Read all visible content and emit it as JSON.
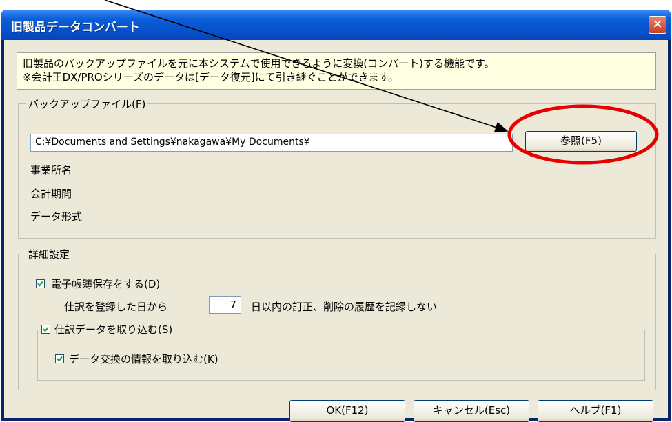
{
  "window": {
    "title": "旧製品データコンバート",
    "close_glyph": "✕"
  },
  "info": {
    "line1": "旧製品のバックアップファイルを元に本システムで使用できるように変換(コンバート)する機能です。",
    "line2": "※会計王DX/PROシリーズのデータは[データ復元]にて引き継ぐことができます。"
  },
  "backup": {
    "group_label": "バックアップファイル(F)",
    "path_value": "C:¥Documents and Settings¥nakagawa¥My Documents¥",
    "browse_label": "参照(F5)",
    "fields": [
      "事業所名",
      "会計期間",
      "データ形式"
    ]
  },
  "details": {
    "group_label": "詳細設定",
    "ebook_label": "電子帳簿保存をする(D)",
    "ebook_checked": true,
    "days_prefix": "仕訳を登録した日から",
    "days_value": "7",
    "days_suffix": "日以内の訂正、削除の履歴を記録しない",
    "import_journal_label": "仕訳データを取り込む(S)",
    "import_journal_checked": true,
    "import_exchange_label": "データ交換の情報を取り込む(K)",
    "import_exchange_checked": true
  },
  "buttons": {
    "ok": "OK(F12)",
    "cancel": "キャンセル(Esc)",
    "help": "ヘルプ(F1)"
  },
  "colors": {
    "titlebar": "#0a5fd8",
    "annotation": "#e60000",
    "info_bg": "#ffffe1",
    "dialog_bg": "#ece9d8"
  }
}
